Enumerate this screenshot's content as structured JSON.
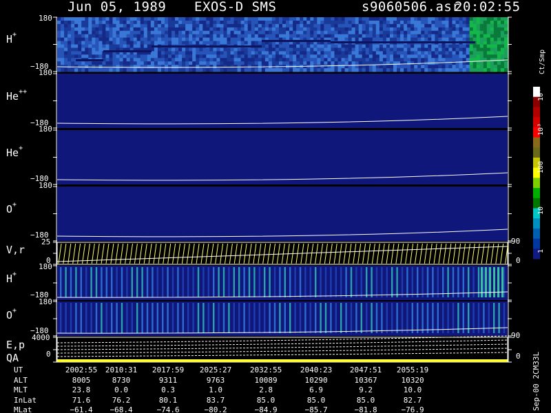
{
  "header": {
    "date": "Jun 05, 1989",
    "instrument": "EXOS-D SMS",
    "file": "s9060506.asr",
    "time": "20:02:55"
  },
  "colors": {
    "background": "#000000",
    "panel_fill": "#10177a",
    "curve": "#ffffff",
    "vr_curve": "#ffff66",
    "qa_bar": "#ffff33"
  },
  "panels": [
    {
      "key": "h_plus_top",
      "species": "H",
      "charge": "+",
      "tick_top": "180",
      "tick_bottom": "−180"
    },
    {
      "key": "he_plus_plus",
      "species": "He",
      "charge": "++",
      "tick_top": "180",
      "tick_bottom": "−180"
    },
    {
      "key": "he_plus",
      "species": "He",
      "charge": "+",
      "tick_top": "180",
      "tick_bottom": "−180"
    },
    {
      "key": "o_plus_top",
      "species": "O",
      "charge": "+",
      "tick_top": "180",
      "tick_bottom": "−180"
    },
    {
      "key": "vr",
      "species": "V,r",
      "charge": "",
      "tick_top": "25",
      "tick_bottom": "0",
      "right_top": "90",
      "right_bottom": "0"
    },
    {
      "key": "h_plus_bottom",
      "species": "H",
      "charge": "+",
      "tick_top": "180",
      "tick_bottom": "−180"
    },
    {
      "key": "o_plus_bottom",
      "species": "O",
      "charge": "+",
      "tick_top": "180",
      "tick_bottom": "−180"
    },
    {
      "key": "ep_qa",
      "species": "E,p",
      "species2": "QA",
      "tick_top": "4000",
      "tick_bottom": "0",
      "right_top": "90",
      "right_bottom": "0"
    }
  ],
  "colorbar": {
    "unit": "Ct/Smp",
    "labels": [
      "10⁴",
      "10³",
      "100",
      "10",
      "1"
    ],
    "colors": [
      "#ffffff",
      "#8a0000",
      "#b00000",
      "#d40000",
      "#ff0000",
      "#8a6a1a",
      "#6a6a1a",
      "#c8c800",
      "#ffff00",
      "#80d000",
      "#00b000",
      "#007800",
      "#00c8c8",
      "#0090c0",
      "#0060b0",
      "#0038a0",
      "#101a80"
    ]
  },
  "footer": {
    "side_note": "Sep-00 2CM33L",
    "rows": [
      {
        "name": "UT",
        "values": [
          "2002:55",
          "2010:31",
          "2017:59",
          "2025:27",
          "2032:55",
          "2040:23",
          "2047:51",
          "2055:19"
        ]
      },
      {
        "name": "ALT",
        "values": [
          "8005",
          "8730",
          "9311",
          "9763",
          "10089",
          "10290",
          "10367",
          "10320"
        ]
      },
      {
        "name": "MLT",
        "values": [
          "23.8",
          "0.0",
          "0.3",
          "1.0",
          "2.8",
          "6.9",
          "9.2",
          "10.0"
        ]
      },
      {
        "name": "InLat",
        "values": [
          "71.6",
          "76.2",
          "80.1",
          "83.7",
          "85.0",
          "85.0",
          "85.0",
          "82.7"
        ]
      },
      {
        "name": "MLat",
        "values": [
          "−61.4",
          "−68.4",
          "−74.6",
          "−80.2",
          "−84.9",
          "−85.7",
          "−81.8",
          "−76.9"
        ]
      }
    ]
  },
  "chart_data": {
    "type": "heatmap",
    "title": "Jun 05, 1989   EXOS-D SMS",
    "x_ticks_ut": [
      "2002:55",
      "2010:31",
      "2017:59",
      "2025:27",
      "2032:55",
      "2040:23",
      "2047:51",
      "2055:19"
    ],
    "colorbar_unit": "Ct/Smp",
    "colorbar_scale": "log",
    "colorbar_range": [
      1,
      10000
    ],
    "panels": [
      "H+",
      "He++",
      "He+",
      "O+",
      "V,r",
      "H+",
      "O+",
      "E,p / QA"
    ],
    "pitch_angle_range": [
      -180,
      180
    ],
    "vr_range": [
      0,
      25
    ],
    "energy_range": [
      0,
      4000
    ]
  }
}
